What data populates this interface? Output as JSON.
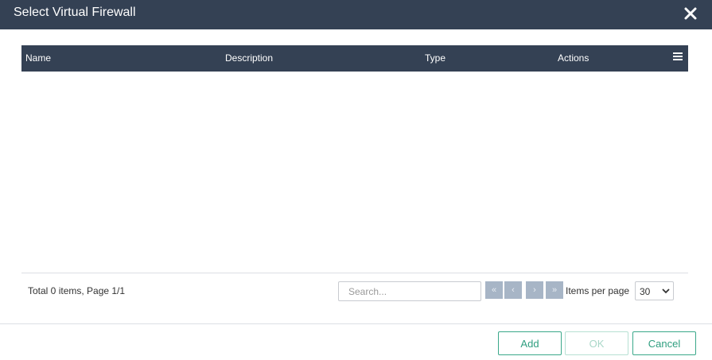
{
  "dialog": {
    "title": "Select Virtual Firewall"
  },
  "table": {
    "columns": [
      "Name",
      "Description",
      "Type",
      "Actions"
    ],
    "rows": []
  },
  "footer": {
    "total_text": "Total 0 items, Page 1/1",
    "search_placeholder": "Search...",
    "pager": {
      "first": "«",
      "prev": "‹",
      "next": "›",
      "last": "»"
    },
    "items_per_page_label": "Items per page",
    "items_per_page_value": "30"
  },
  "actions": {
    "add_label": "Add",
    "ok_label": "OK",
    "cancel_label": "Cancel"
  },
  "icons": {
    "close": "close-icon",
    "column_menu": "menu-icon",
    "select_chevron": "chevron-down-icon"
  },
  "colors": {
    "header_bg": "#344154",
    "accent": "#2e9e7f",
    "pager_bg": "#a7b5c6"
  }
}
